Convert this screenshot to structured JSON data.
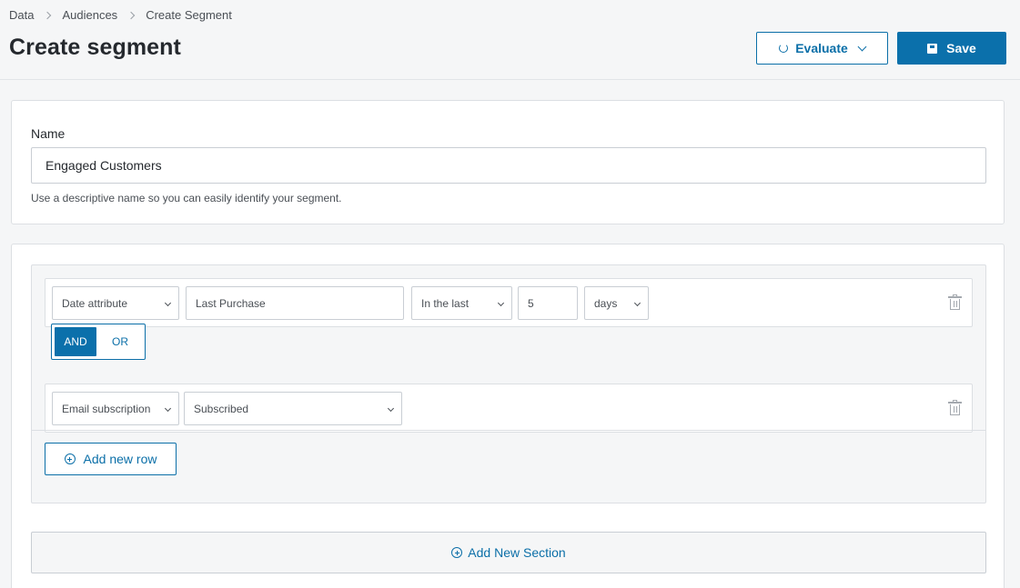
{
  "breadcrumb": {
    "items": [
      "Data",
      "Audiences",
      "Create Segment"
    ]
  },
  "page": {
    "title": "Create segment"
  },
  "toolbar": {
    "evaluate_label": "Evaluate",
    "save_label": "Save"
  },
  "name_card": {
    "label": "Name",
    "value": "Engaged Customers",
    "help_text": "Use a descriptive name so you can easily identify your segment."
  },
  "section": {
    "rows": [
      {
        "attribute_type": "Date attribute",
        "attribute_name": "Last Purchase",
        "operator": "In the last",
        "amount": "5",
        "unit": "days"
      },
      {
        "attribute_type": "Email subscription",
        "value": "Subscribed"
      }
    ],
    "logic": {
      "and_label": "AND",
      "or_label": "OR",
      "selected": "AND"
    },
    "add_row_label": "Add new row"
  },
  "add_section_label": "Add New Section",
  "colors": {
    "accent": "#0b70ab",
    "border": "#dcdfe3",
    "background": "#f5f6f7"
  },
  "icons": [
    "chevron-right-icon",
    "refresh-icon",
    "chevron-down-icon",
    "save-icon",
    "trash-icon",
    "plus-circle-icon"
  ]
}
